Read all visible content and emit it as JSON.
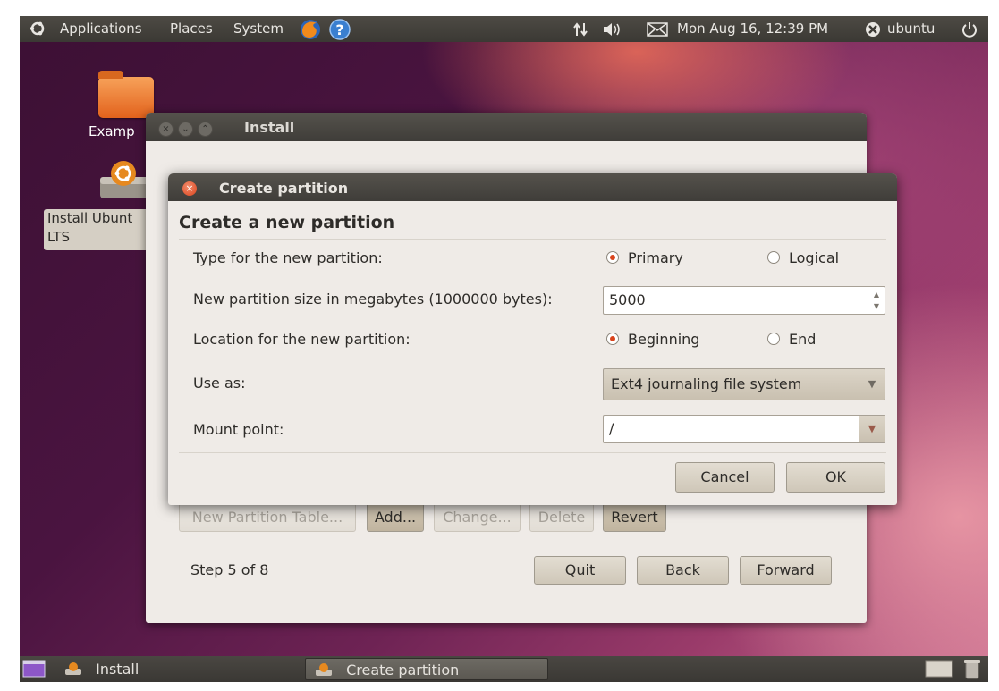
{
  "top_panel": {
    "menus": [
      "Applications",
      "Places",
      "System"
    ],
    "clock": "Mon Aug 16, 12:39 PM",
    "user": "ubuntu",
    "icons": [
      "ubuntu-logo-icon",
      "firefox-icon",
      "help-icon",
      "network-icon",
      "volume-icon",
      "mail-icon",
      "user-status-icon",
      "power-icon"
    ]
  },
  "desktop": {
    "icons": [
      {
        "label": "Examp"
      },
      {
        "label": "Install Ubunt\nLTS"
      }
    ]
  },
  "install_window": {
    "title": "Install",
    "buttons": {
      "new_table": "New Partition Table...",
      "add": "Add...",
      "change": "Change...",
      "delete": "Delete",
      "revert": "Revert",
      "quit": "Quit",
      "back": "Back",
      "forward": "Forward"
    },
    "step": "Step 5 of 8"
  },
  "dialog": {
    "title": "Create partition",
    "heading": "Create a new partition",
    "type_label": "Type for the new partition:",
    "type_options": [
      "Primary",
      "Logical"
    ],
    "type_selected": "Primary",
    "size_label": "New partition size in megabytes (1000000 bytes):",
    "size_value": "5000",
    "location_label": "Location for the new partition:",
    "location_options": [
      "Beginning",
      "End"
    ],
    "location_selected": "Beginning",
    "use_as_label": "Use as:",
    "use_as_value": "Ext4 journaling file system",
    "mount_label": "Mount point:",
    "mount_value": "/",
    "cancel": "Cancel",
    "ok": "OK"
  },
  "bottom_panel": {
    "tasks": [
      "Install",
      "Create partition"
    ],
    "active_task": "Create partition"
  },
  "colors": {
    "accent": "#d9441d",
    "panel": "#3b3934",
    "window_bg": "#efebe7"
  }
}
